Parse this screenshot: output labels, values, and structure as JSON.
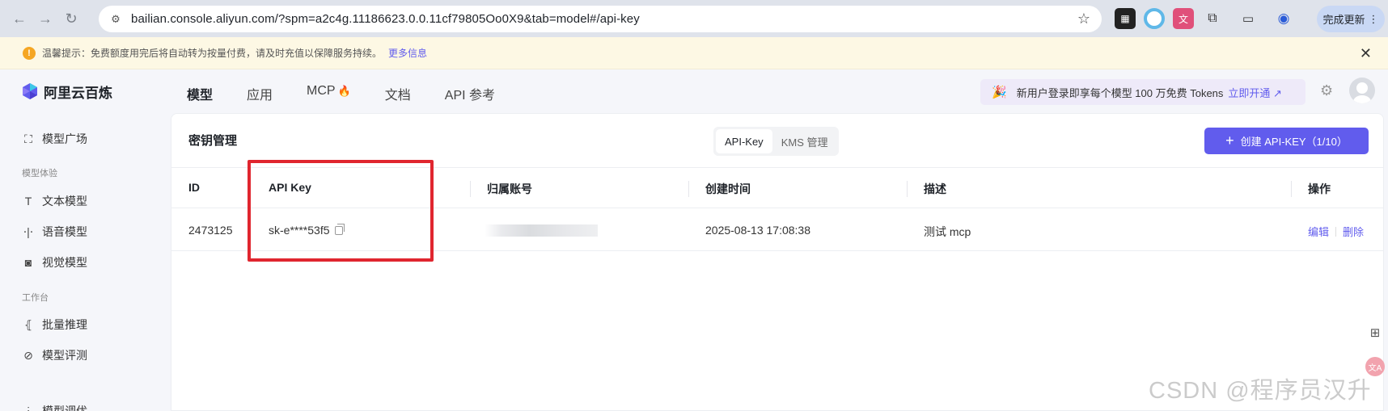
{
  "browser": {
    "url": "bailian.console.aliyun.com/?spm=a2c4g.11186623.0.0.11cf79805Oo0X9&tab=model#/api-key",
    "update_label": "完成更新"
  },
  "notice": {
    "text": "温馨提示：免费额度用完后将自动转为按量付费，请及时充值以保障服务持续。",
    "more": "更多信息"
  },
  "header": {
    "logo": "阿里云百炼",
    "nav": [
      "模型",
      "应用",
      "MCP",
      "文档",
      "API 参考"
    ],
    "promo_text": "新用户登录即享每个模型 100 万免费 Tokens",
    "promo_link": "立即开通 ↗"
  },
  "sidebar": {
    "top_item": "模型广场",
    "group1": "模型体验",
    "group1_items": [
      "文本模型",
      "语音模型",
      "视觉模型"
    ],
    "group2": "工作台",
    "group2_items": [
      "批量推理",
      "模型评测",
      "模型调优"
    ]
  },
  "main": {
    "title": "密钥管理",
    "tabs": [
      "API-Key",
      "KMS 管理"
    ],
    "create_label": "创建 API-KEY（1/10）",
    "columns": [
      "ID",
      "API Key",
      "归属账号",
      "创建时间",
      "描述",
      "操作"
    ],
    "rows": [
      {
        "id": "2473125",
        "api_key": "sk-e****53f5",
        "created": "2025-08-13 17:08:38",
        "desc": "测试 mcp",
        "edit": "编辑",
        "delete": "删除"
      }
    ]
  },
  "watermark": "CSDN @程序员汉升",
  "colors": {
    "accent": "#615ced",
    "highlight": "#e0262f",
    "notice_bg": "#fdf8e4"
  }
}
